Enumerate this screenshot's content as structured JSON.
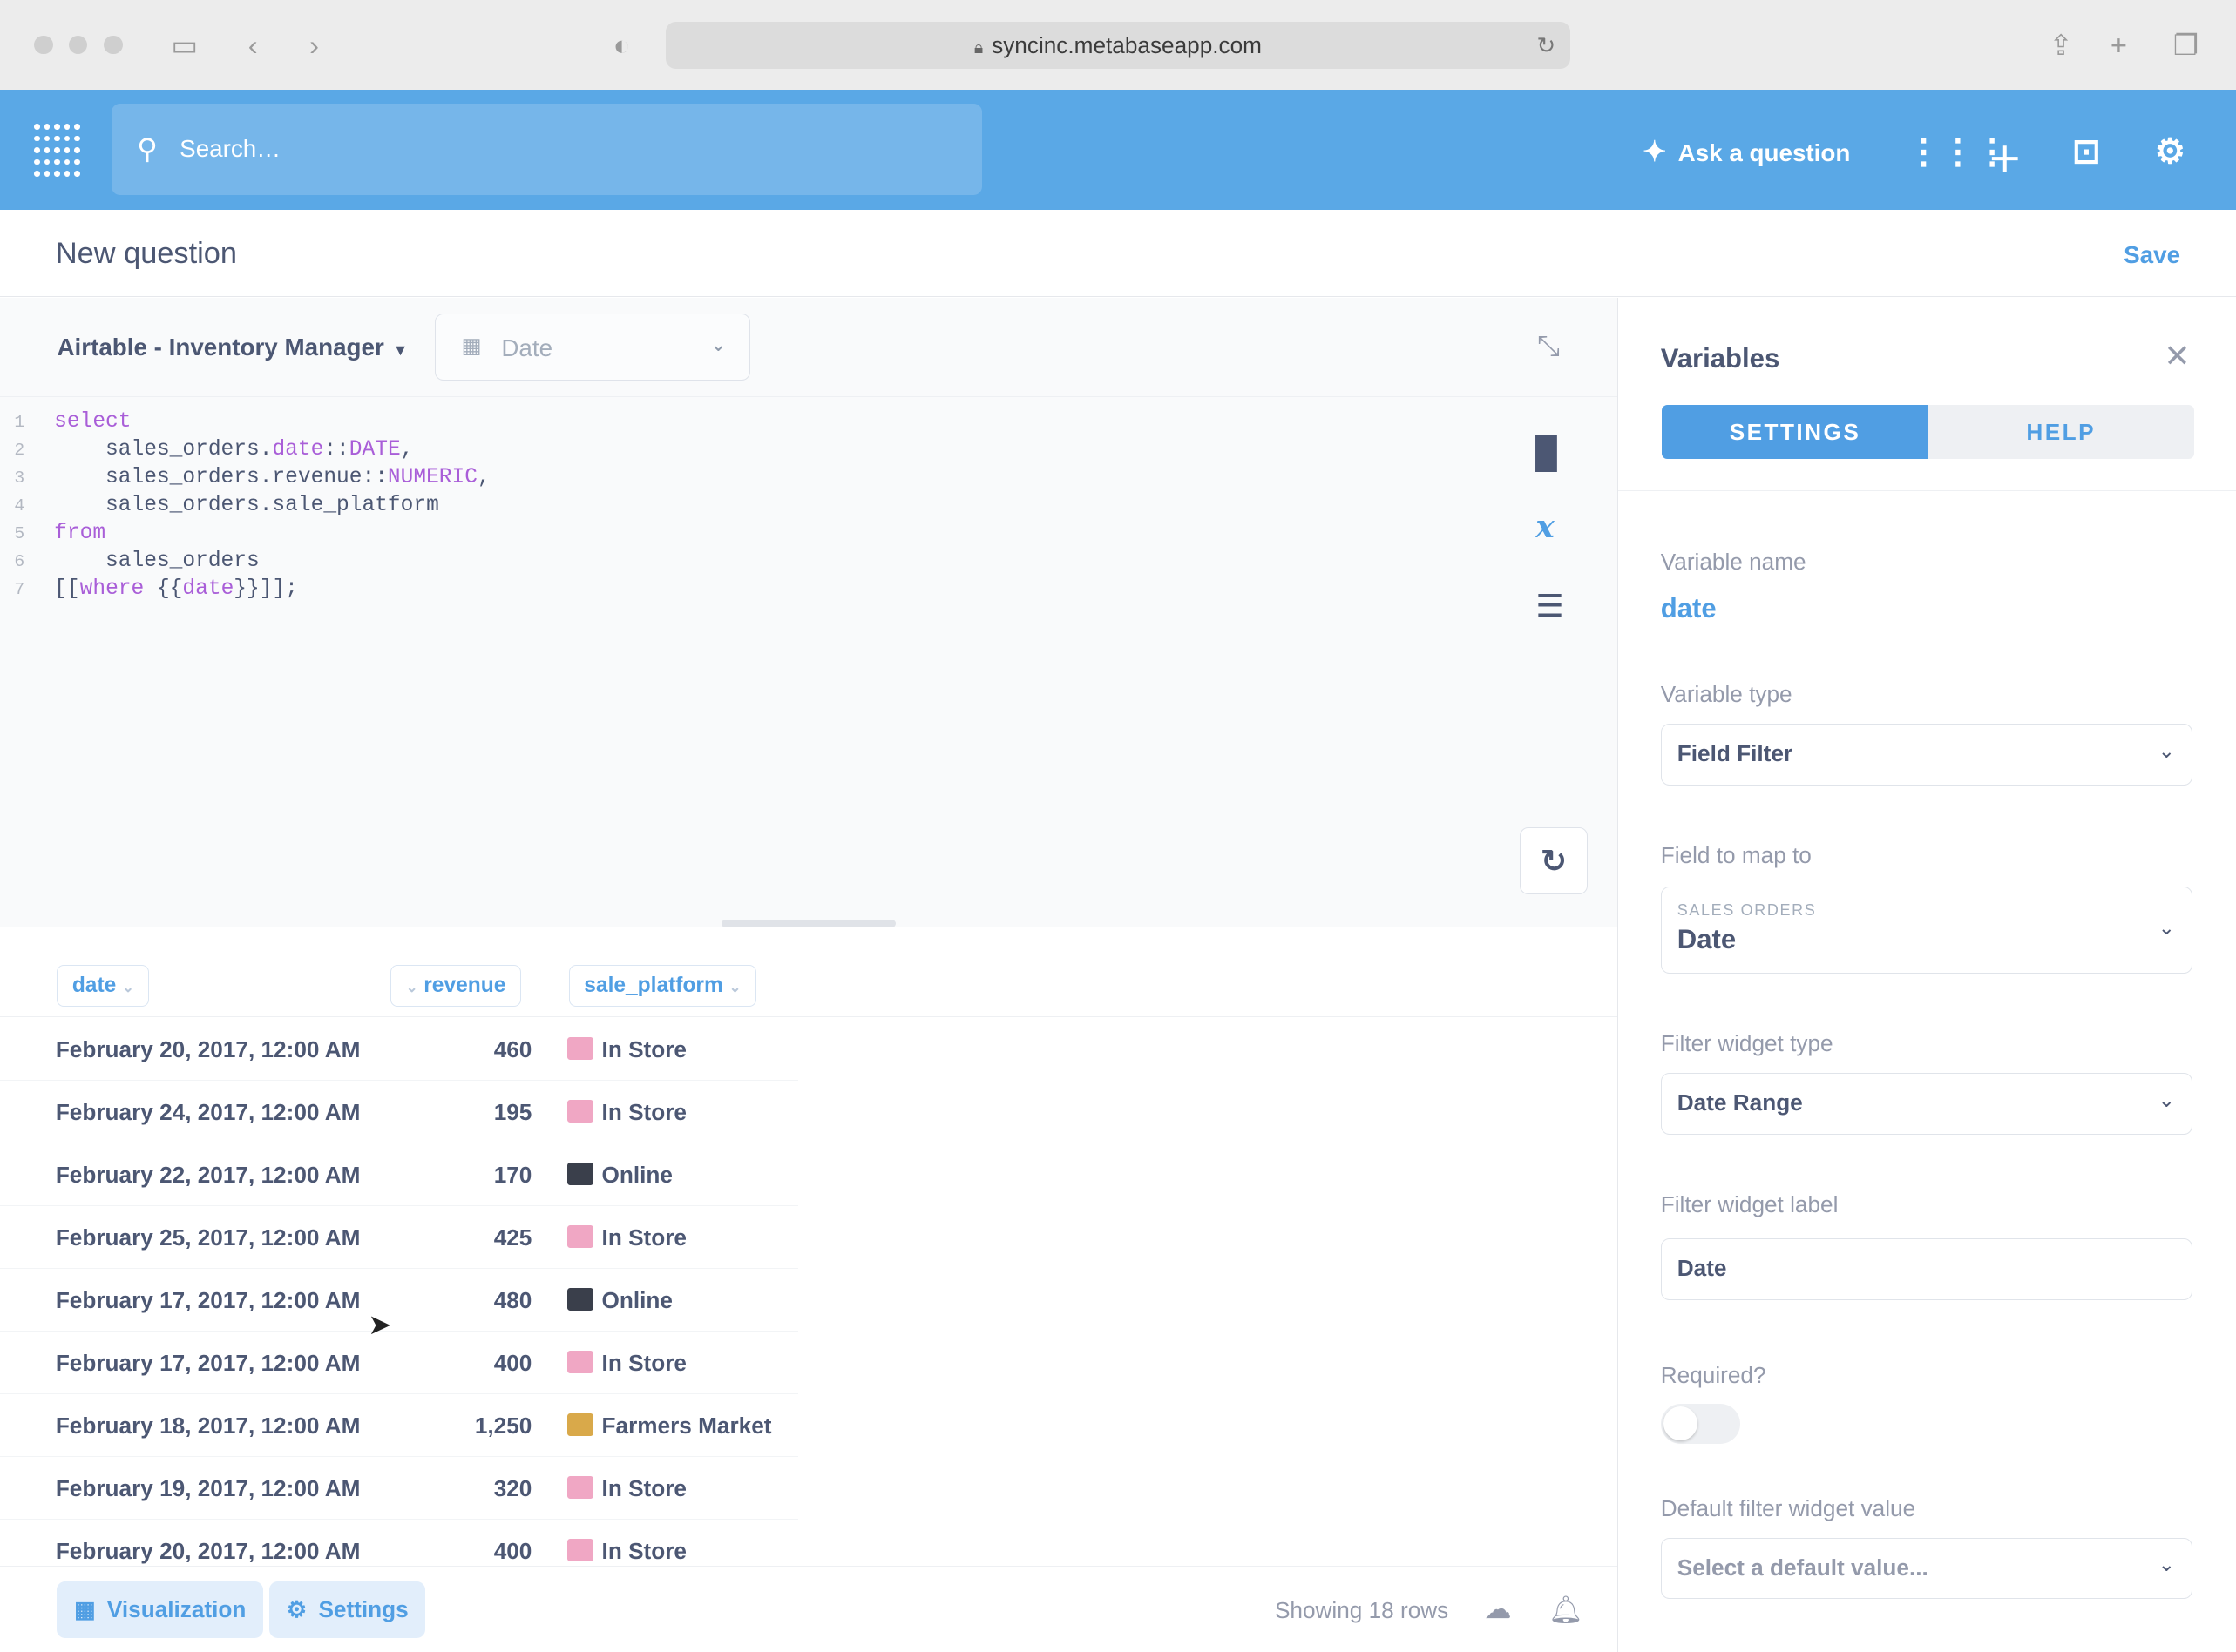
{
  "browser": {
    "url": "syncinc.metabaseapp.com"
  },
  "nav": {
    "search_placeholder": "Search…",
    "ask_label": "Ask a question"
  },
  "header": {
    "title": "New question",
    "save_label": "Save"
  },
  "toolbar": {
    "database": "Airtable - Inventory Manager",
    "date_widget": "Date"
  },
  "editor": {
    "line_numbers": [
      "1",
      "2",
      "3",
      "4",
      "5",
      "6",
      "7"
    ]
  },
  "results": {
    "columns": [
      "date",
      "revenue",
      "sale_platform"
    ],
    "rows": [
      {
        "date": "February 20, 2017, 12:00 AM",
        "revenue": "460",
        "platform": "In Store"
      },
      {
        "date": "February 24, 2017, 12:00 AM",
        "revenue": "195",
        "platform": "In Store"
      },
      {
        "date": "February 22, 2017, 12:00 AM",
        "revenue": "170",
        "platform": "Online"
      },
      {
        "date": "February 25, 2017, 12:00 AM",
        "revenue": "425",
        "platform": "In Store"
      },
      {
        "date": "February 17, 2017, 12:00 AM",
        "revenue": "480",
        "platform": "Online"
      },
      {
        "date": "February 17, 2017, 12:00 AM",
        "revenue": "400",
        "platform": "In Store"
      },
      {
        "date": "February 18, 2017, 12:00 AM",
        "revenue": "1,250",
        "platform": "Farmers Market"
      },
      {
        "date": "February 19, 2017, 12:00 AM",
        "revenue": "320",
        "platform": "In Store"
      },
      {
        "date": "February 20, 2017, 12:00 AM",
        "revenue": "400",
        "platform": "In Store"
      }
    ]
  },
  "footer": {
    "visualization_label": "Visualization",
    "settings_label": "Settings",
    "rows_text": "Showing 18 rows"
  },
  "panel": {
    "title": "Variables",
    "tab_settings": "SETTINGS",
    "tab_help": "HELP",
    "variable_name_label": "Variable name",
    "variable_name": "date",
    "variable_type_label": "Variable type",
    "variable_type": "Field Filter",
    "field_map_label": "Field to map to",
    "field_table": "SALES ORDERS",
    "field_name": "Date",
    "widget_type_label": "Filter widget type",
    "widget_type": "Date Range",
    "widget_label_label": "Filter widget label",
    "widget_label": "Date",
    "required_label": "Required?",
    "required": false,
    "default_label": "Default filter widget value",
    "default_placeholder": "Select a default value..."
  },
  "colors": {
    "brand": "#509ee3",
    "nav_bg": "#5aa8e6",
    "keyword": "#a95ed8"
  }
}
